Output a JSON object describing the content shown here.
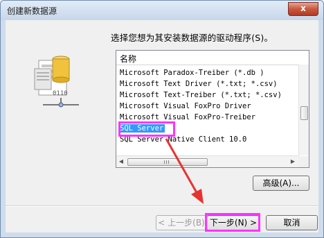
{
  "window": {
    "title": "创建新数据源",
    "close_label": "x"
  },
  "prompt": "选择您想为其安装数据源的驱动程序(S)。",
  "list": {
    "column_header": "名称",
    "items": [
      "Microsoft Paradox-Treiber (*.db )",
      "Microsoft Text Driver (*.txt; *.csv)",
      "Microsoft Text-Treiber (*.txt; *.csv)",
      "Microsoft Visual FoxPro Driver",
      "Microsoft Visual FoxPro-Treiber",
      "SQL Server",
      "SQL Server Native Client 10.0"
    ],
    "selected": "SQL Server"
  },
  "buttons": {
    "advanced": "高级(A)...",
    "back": "< 上一步(B)",
    "next": "下一步(N) >",
    "cancel": "取消"
  },
  "icon": {
    "name": "database-wizard-icon",
    "label": "0110"
  },
  "colors": {
    "selection": "#3399ff",
    "highlight": "#ff33ff",
    "annotation_arrow": "#e8322e"
  }
}
